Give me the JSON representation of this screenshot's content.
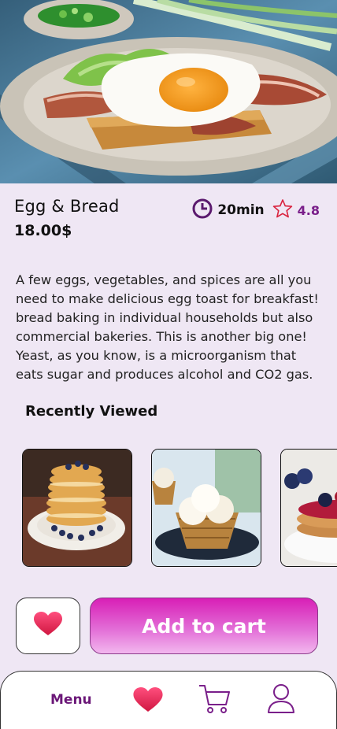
{
  "product": {
    "name": "Egg & Bread",
    "price": "18.00$",
    "time": "20min",
    "rating": "4.8",
    "description": "A few eggs, vegetables, and spices are all you need to make delicious egg toast for breakfast! bread baking in individual households but also commercial bakeries. This is another big one! Yeast, as you know, is a microorganism that eats sugar and produces alcohol and CO2 gas."
  },
  "recently_viewed": {
    "title": "Recently Viewed",
    "items": [
      "pancake-stack",
      "ice-cream-waffle",
      "berry-pancakes"
    ]
  },
  "actions": {
    "add_to_cart_label": "Add to cart"
  },
  "nav": {
    "menu_label": "Menu"
  },
  "colors": {
    "background": "#efe7f4",
    "accent": "#7a1f8a",
    "button_gradient_top": "#d81fb6",
    "heart": "#e0204f"
  },
  "icons": [
    "clock-icon",
    "star-icon",
    "heart-icon",
    "cart-icon",
    "user-icon"
  ]
}
